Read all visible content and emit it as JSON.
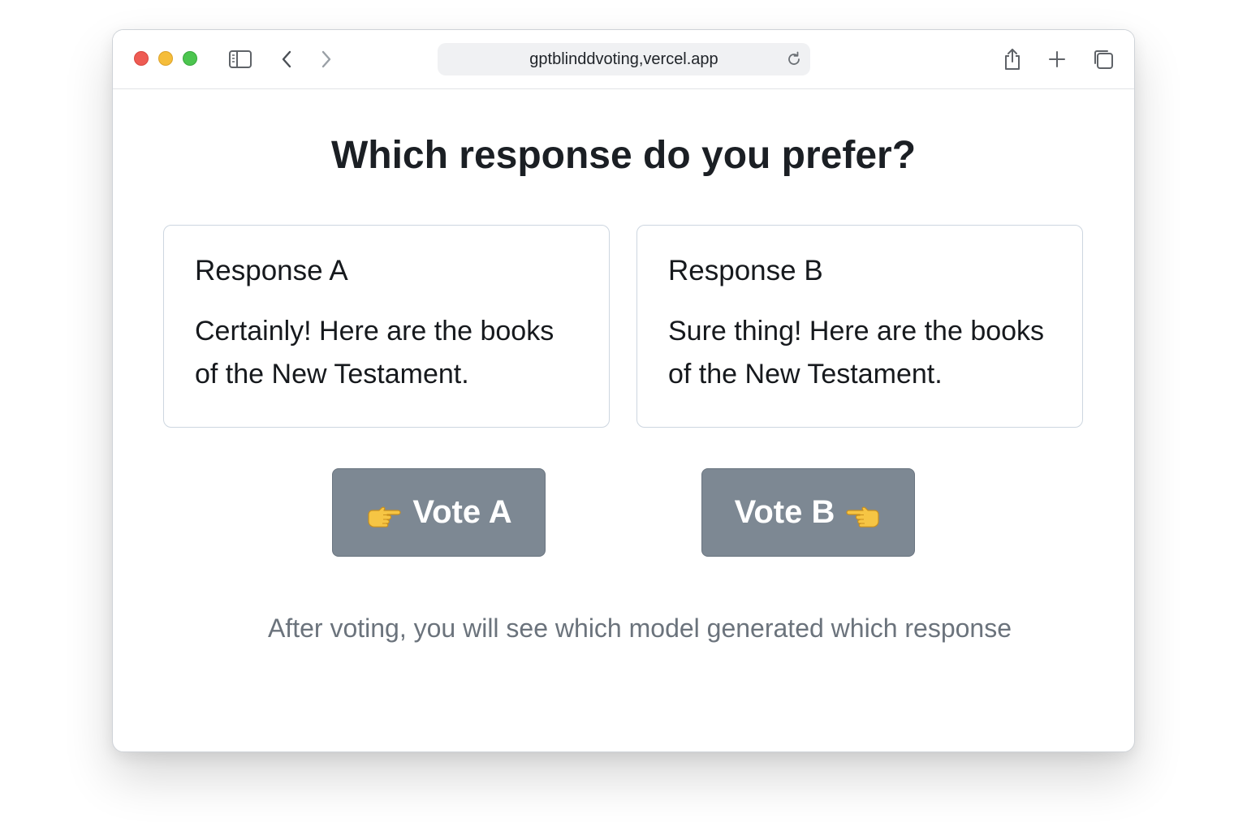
{
  "browser": {
    "url": "gptblinddvoting,vercel.app"
  },
  "page": {
    "title": "Which response do you prefer?",
    "responses": [
      {
        "heading": "Response A",
        "text": "Certainly! Here are the books of the New Testament."
      },
      {
        "heading": "Response B",
        "text": "Sure thing! Here are the books of the New Testament."
      }
    ],
    "vote_a_label": "Vote A",
    "vote_b_label": "Vote B",
    "footer_note": "After voting, you will see which model generated which response"
  },
  "icons": {
    "vote_a": "pointing-right-hand-icon",
    "vote_b": "pointing-left-hand-icon"
  },
  "colors": {
    "button_bg": "#7d8893",
    "traffic_red": "#ee5b53",
    "traffic_yellow": "#f5bd3a",
    "traffic_green": "#4cc54f"
  }
}
